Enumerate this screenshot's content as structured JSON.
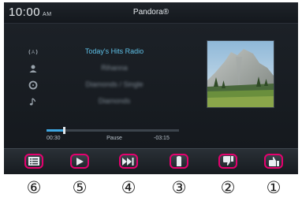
{
  "status_bar": {
    "time": "10:00",
    "ampm": "AM",
    "app_title": "Pandora®"
  },
  "now_playing": {
    "station": "Today's Hits Radio",
    "artist": "Rihanna",
    "album": "Diamonds / Single",
    "track": "Diamonds"
  },
  "playback": {
    "elapsed": "00:30",
    "state": "Pause",
    "remaining": "-03:15",
    "progress": 0.13
  },
  "controls": [
    {
      "name": "menu-button",
      "icon": "list-icon",
      "callout": "⑥"
    },
    {
      "name": "play-button",
      "icon": "play-icon",
      "callout": "⑤"
    },
    {
      "name": "skip-button",
      "icon": "skip-forward-icon",
      "callout": "④"
    },
    {
      "name": "bookmark-button",
      "icon": "bookmark-icon",
      "callout": "③"
    },
    {
      "name": "thumbs-down-button",
      "icon": "thumbs-down-icon",
      "callout": "②"
    },
    {
      "name": "thumbs-up-button",
      "icon": "thumbs-up-icon",
      "callout": "①"
    }
  ],
  "colors": {
    "accent": "#5ec1e8",
    "highlight": "#e5006e",
    "background": "#15191e"
  }
}
